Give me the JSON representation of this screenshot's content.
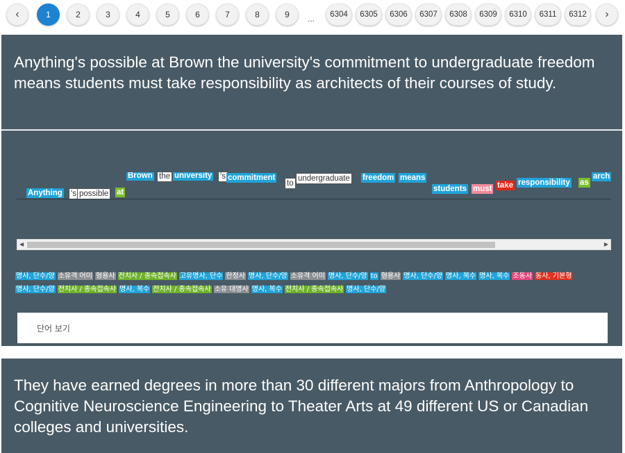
{
  "pagination": {
    "prev_icon": "chevron-left-icon",
    "next_icon": "chevron-right-icon",
    "active_page": "1",
    "pages_start": [
      "1",
      "2",
      "3",
      "4",
      "5",
      "6",
      "7",
      "8",
      "9"
    ],
    "ellipsis": "...",
    "pages_end": [
      "6304",
      "6305",
      "6306",
      "6307",
      "6308",
      "6309",
      "6310",
      "6311",
      "6312"
    ],
    "active_color": "#1d82d2"
  },
  "sentence1": "Anything's possible at Brown the university's commitment to undergraduate freedom means students must take responsibility as architects of their courses of study.",
  "analysis": {
    "tokens": [
      {
        "text": "Anything",
        "style": "blue"
      },
      {
        "text": "'s",
        "style": "white"
      },
      {
        "text": "possible",
        "style": "white"
      },
      {
        "text": "at",
        "style": "green"
      },
      {
        "text": "Brown",
        "style": "blue"
      },
      {
        "text": "the",
        "style": "white"
      },
      {
        "text": "university",
        "style": "blue"
      },
      {
        "text": "'s",
        "style": "white"
      },
      {
        "text": "commitment",
        "style": "blue"
      },
      {
        "text": "to",
        "style": "white"
      },
      {
        "text": "undergraduate",
        "style": "white"
      },
      {
        "text": "freedom",
        "style": "blue"
      },
      {
        "text": "means",
        "style": "blue"
      },
      {
        "text": "students",
        "style": "blue"
      },
      {
        "text": "must",
        "style": "pink"
      },
      {
        "text": "take",
        "style": "red"
      },
      {
        "text": "responsibility",
        "style": "blue"
      },
      {
        "text": "as",
        "style": "green"
      },
      {
        "text": "arch",
        "style": "blue"
      }
    ],
    "tags": [
      {
        "text": "명사, 단수/양",
        "style": "blue"
      },
      {
        "text": "소유격 어미",
        "style": "gray"
      },
      {
        "text": "형용사",
        "style": "gray"
      },
      {
        "text": "전치사 / 종속접속사",
        "style": "green"
      },
      {
        "text": "고유명사, 단수",
        "style": "blue"
      },
      {
        "text": "한정사",
        "style": "gray"
      },
      {
        "text": "명사, 단수/양",
        "style": "blue"
      },
      {
        "text": "소유격 어미",
        "style": "gray"
      },
      {
        "text": "명사, 단수/양",
        "style": "blue"
      },
      {
        "text": "to",
        "style": "blue"
      },
      {
        "text": "형용사",
        "style": "gray"
      },
      {
        "text": "명사, 단수/양",
        "style": "blue"
      },
      {
        "text": "명사, 복수",
        "style": "blue"
      },
      {
        "text": "명사, 복수",
        "style": "blue"
      },
      {
        "text": "조동사",
        "style": "pink"
      },
      {
        "text": "동사, 기본형",
        "style": "red"
      },
      {
        "text": "명사, 단수/양",
        "style": "blue"
      },
      {
        "text": "전치사 / 종속접속사",
        "style": "green"
      },
      {
        "text": "명사, 복수",
        "style": "blue"
      },
      {
        "text": "전치사 / 종속접속사",
        "style": "green"
      },
      {
        "text": "소유 대명사",
        "style": "gray"
      },
      {
        "text": "명사, 복수",
        "style": "blue"
      },
      {
        "text": "전치사 / 종속접속사",
        "style": "green"
      },
      {
        "text": "명사, 단수/양",
        "style": "blue"
      }
    ],
    "word_view_label": "단어 보기"
  },
  "sentence2": "They have earned degrees in more than 30 different majors from Anthropology to Cognitive Neuroscience Engineering to Theater Arts at 49 different US or Canadian colleges and universities."
}
